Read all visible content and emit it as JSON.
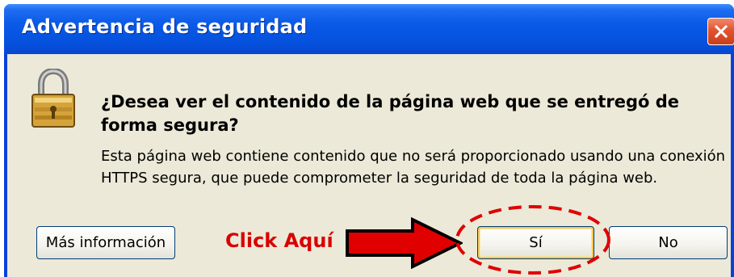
{
  "dialog": {
    "title": "Advertencia de seguridad",
    "question": "¿Desea ver el contenido de la página web que se entregó de forma segura?",
    "message": "Esta página web contiene contenido que no será proporcionado usando una conexión HTTPS segura, que puede comprometer la seguridad de toda la página web.",
    "icon": "lock-icon"
  },
  "buttons": {
    "more_info": "Más información",
    "yes": "Sí",
    "no": "No"
  },
  "annotation": {
    "label": "Click Aquí",
    "color": "#d90000"
  },
  "colors": {
    "titlebar": "#0a5ae8",
    "client_bg": "#ece9d8",
    "close": "#e2532f"
  }
}
